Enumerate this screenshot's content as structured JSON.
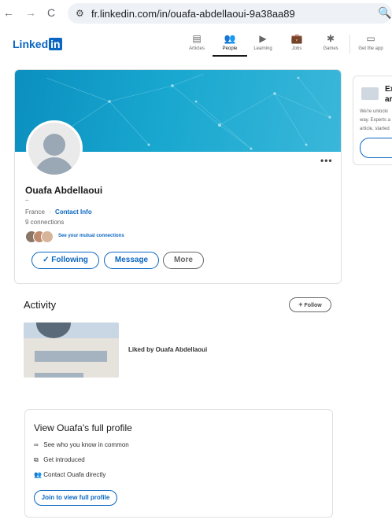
{
  "browser": {
    "back_icon": "back-arrow-icon",
    "forward_icon": "forward-arrow-icon",
    "reload_icon": "reload-icon",
    "url": "fr.linkedin.com/in/ouafa-abdellaoui-9a38aa89"
  },
  "header": {
    "logo_text": "Linked",
    "logo_in": "in",
    "nav": [
      {
        "label": "Articles",
        "icon": "articles-icon"
      },
      {
        "label": "People",
        "icon": "people-icon",
        "active": true
      },
      {
        "label": "Learning",
        "icon": "learning-icon"
      },
      {
        "label": "Jobs",
        "icon": "jobs-icon"
      },
      {
        "label": "Games",
        "icon": "games-icon"
      },
      {
        "label": "Get the app",
        "icon": "laptop-icon"
      }
    ]
  },
  "profile": {
    "more_glyph": "•••",
    "name": "Ouafa Abdellaoui",
    "headline": "--",
    "location": "France",
    "separator": "·",
    "contact_info": "Contact Info",
    "connections": "9 connections",
    "mutual": "See your mutual connections",
    "actions": {
      "following": "Following",
      "following_check": "✓",
      "message": "Message",
      "more": "More"
    }
  },
  "sidebar": {
    "title_line1": "Ex",
    "title_line2": "ar",
    "text_line1": "We're unlocki",
    "text_line2": "way. Experts a",
    "text_line3": "article, started"
  },
  "activity": {
    "title": "Activity",
    "follow_plus": "+",
    "follow_label": "Follow",
    "item_label": "Liked by Ouafa Abdellaoui"
  },
  "cta": {
    "title": "View Ouafa's full profile",
    "items": [
      {
        "icon": "infinity-icon",
        "glyph": "∞",
        "label": "See who you know in common"
      },
      {
        "icon": "introduce-icon",
        "glyph": "⧉",
        "label": "Get introduced"
      },
      {
        "icon": "people-contact-icon",
        "glyph": "👥",
        "label": "Contact Ouafa directly"
      }
    ],
    "button": "Join to view full profile"
  },
  "colors": {
    "brand": "#0a66c2",
    "banner": "#18a7cf"
  }
}
